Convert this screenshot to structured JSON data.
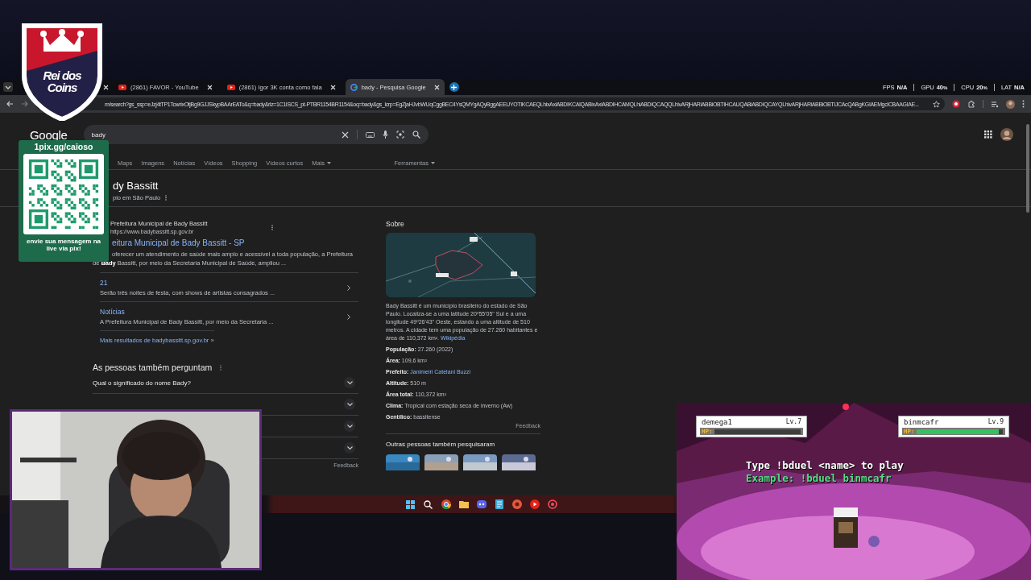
{
  "stream_logo": {
    "lines": [
      "Rei dos",
      "Coins"
    ]
  },
  "pix_card": {
    "url": "1pix.gg/caioso",
    "message": "envie sua mensagem na live via pix!"
  },
  "browser": {
    "tabs": [
      {
        "title": "(2861) FAVOR - YouTube",
        "kind": "youtube",
        "selected": false
      },
      {
        "title": "(2861) Igor 3K conta como fala",
        "kind": "youtube",
        "selected": false
      },
      {
        "title": "bady - Pesquisa Google",
        "kind": "google",
        "selected": true
      }
    ],
    "address": "m/search?gs_ssp=eJzj4tTP1TcwrixOtjBg9GJJSkypBAArEATo&q=bady&rlz=1C1ISCS_pt-PTBR1154BR1154&oq=bady&gs_lcrp=EgZjaHJvbWUqCggBEC4YsQMYgAQyBggAEEUYOTIKCAEQLhixAxiABDIKCAIQABixAxiABDIHCAMQLhiABDIQCAQQLhivARjHARiABBiOBTIHCAUQABiABDIQCAYQLhivARjHARiABBiOBTIJCAcQABgKGIAEMgcICBAAGIAE...",
    "stats": [
      {
        "label": "FPS",
        "value": "N/A"
      },
      {
        "label": "GPU",
        "value": "40",
        "unit": "%"
      },
      {
        "label": "CPU",
        "value": "20",
        "unit": "%"
      },
      {
        "label": "LAT",
        "value": "N/A"
      }
    ]
  },
  "google": {
    "logo": "Google",
    "query": "bady",
    "nav": [
      "Maps",
      "Imagens",
      "Notícias",
      "Vídeos",
      "Shopping",
      "Vídeos curtos",
      "Mais"
    ],
    "tools": "Ferramentas",
    "entity": {
      "title": "dy Bassitt",
      "subtitle": "pio em São Paulo"
    },
    "result": {
      "site": "Prefeitura Municipal de Bady Bassitt",
      "url": "https://www.badybassitt.sp.gov.br",
      "title": "eitura Municipal de Bady Bassitt - SP",
      "snippet": "oferecer um atendimento de saúde mais amplo e acessível a toda população, a Prefeitura de **Bady** Bassitt, por meio da Secretaria Municipal de Saúde, ampliou ...",
      "sitelinks": [
        {
          "title": "21",
          "text": "Serão três noites de festa, com shows de artistas consagrados ..."
        },
        {
          "title": "Notícias",
          "text": "A Prefeitura Municipal de Bady Bassitt, por meio da Secretaria ..."
        }
      ],
      "more": "Mais resultados de badybassitt.sp.gov.br »"
    },
    "questions": {
      "heading": "As pessoas também perguntam",
      "items": [
        {
          "text": "Qual o significado do nome Bady?",
          "expanded": false
        },
        {
          "expanded": false
        },
        {
          "expanded": false
        },
        {
          "expanded": false
        }
      ],
      "feedback": "Feedback"
    },
    "panel": {
      "heading": "Sobre",
      "description": "Bady Bassitt é um município brasileiro do estado de São Paulo. Localiza-se a uma latitude 20º55'05\" Sul e a uma longitude 49º26'43\" Oeste, estando a uma altitude de 510 metros. A cidade tem uma população de 27.260 habitantes e área de 110,372 km².",
      "source": "Wikipédia",
      "facts": [
        {
          "label": "População:",
          "value": "27.260 (2022)",
          "link": false
        },
        {
          "label": "Área:",
          "value": "109,6 km²",
          "link": false
        },
        {
          "label": "Prefeito:",
          "value": "Janimeiri Catelani Buzzi",
          "link": true
        },
        {
          "label": "Altitude:",
          "value": "510 m",
          "link": false
        },
        {
          "label": "Área total:",
          "value": "110,372 km²",
          "link": false
        },
        {
          "label": "Clima:",
          "value": "Tropical com estação seca de inverno (Aw)",
          "link": false
        },
        {
          "label": "Gentílico:",
          "value": "bassitense",
          "link": false
        }
      ],
      "feedback": "Feedback",
      "related_heading": "Outras pessoas também pesquisaram"
    }
  },
  "taskbar": [
    {
      "kind": "windows"
    },
    {
      "kind": "search"
    },
    {
      "kind": "chrome"
    },
    {
      "kind": "folder"
    },
    {
      "kind": "discord"
    },
    {
      "kind": "notes"
    },
    {
      "kind": "game"
    },
    {
      "kind": "youtube"
    },
    {
      "kind": "record"
    }
  ],
  "game": {
    "players": [
      {
        "name": "demega1",
        "level_label": "Lv.7",
        "hp_label": "HP:",
        "level": 0
      },
      {
        "name": "binmcafr",
        "level_label": "Lv.9",
        "hp_label": "HP:",
        "level": 0.95
      }
    ],
    "prompt": "Type !bduel <name> to play",
    "example": "Example: !bduel binmcafr"
  }
}
